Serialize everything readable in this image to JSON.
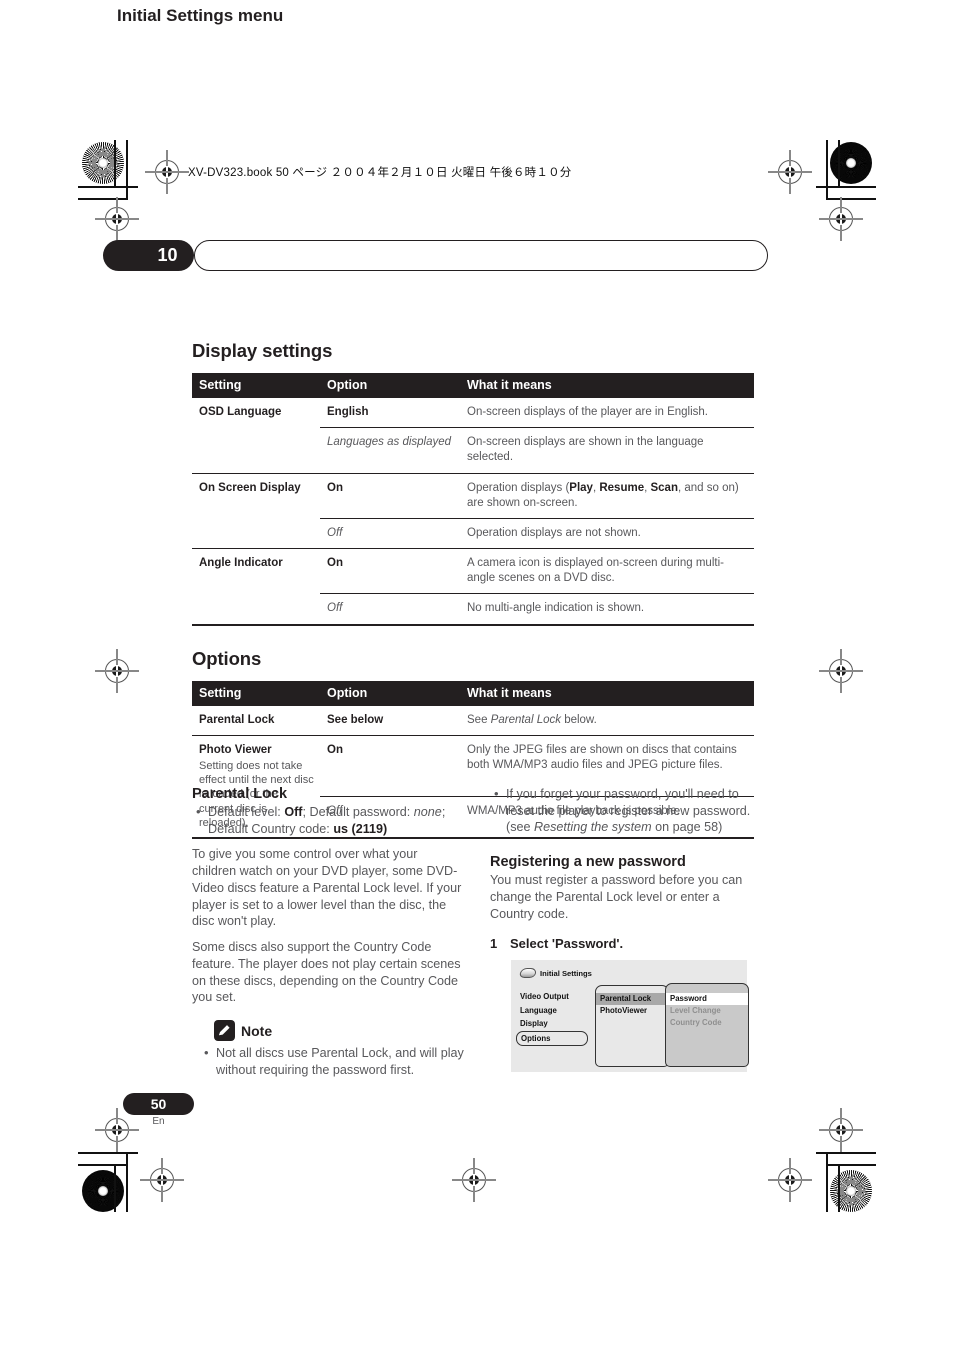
{
  "print": {
    "book_line": "XV-DV323.book  50 ページ  ２００４年２月１０日  火曜日  午後６時１０分"
  },
  "chapter": {
    "number": "10",
    "title": "Initial Settings menu"
  },
  "display_settings": {
    "heading": "Display settings",
    "columns": [
      "Setting",
      "Option",
      "What it means"
    ],
    "rows": [
      {
        "setting": "OSD Language",
        "setting_sub": "",
        "options": [
          {
            "option": "English",
            "style": "bold",
            "means": "On-screen displays of the player are in English."
          },
          {
            "option": "Languages as displayed",
            "style": "italic",
            "means": "On-screen displays are shown in the language selected."
          }
        ]
      },
      {
        "setting": "On Screen Display",
        "setting_sub": "",
        "options": [
          {
            "option": "On",
            "style": "bold",
            "means": "Operation displays (<b>Play</b>, <b>Resume</b>, <b>Scan</b>, and so on) are shown on-screen."
          },
          {
            "option": "Off",
            "style": "italic",
            "means": "Operation displays are not shown."
          }
        ]
      },
      {
        "setting": "Angle Indicator",
        "setting_sub": "",
        "options": [
          {
            "option": "On",
            "style": "bold",
            "means": "A camera icon is displayed on-screen during multi-angle scenes on a DVD disc."
          },
          {
            "option": "Off",
            "style": "italic",
            "means": "No multi-angle indication is shown."
          }
        ]
      }
    ]
  },
  "options_table": {
    "heading": "Options",
    "columns": [
      "Setting",
      "Option",
      "What it means"
    ],
    "rows": [
      {
        "setting": "Parental Lock",
        "setting_sub": "",
        "options": [
          {
            "option": "See below",
            "style": "bold",
            "means": "See <i>Parental Lock</i> below."
          }
        ]
      },
      {
        "setting": "Photo Viewer",
        "setting_sub": "Setting does not take effect until the next disc is loaded (or the current disc is reloaded).",
        "options": [
          {
            "option": "On",
            "style": "bold",
            "means": "Only the JPEG files are shown on discs that contains both WMA/MP3 audio files and JPEG picture files."
          },
          {
            "option": "Off",
            "style": "italic",
            "means": "WMA/MP3 audio file playback is possible."
          }
        ]
      }
    ]
  },
  "parental_lock": {
    "heading": "Parental Lock",
    "defaults_bullet": "Default level: <b>Off</b>; Default password: <i>none</i>; Default Country code: <b>us (2119)</b>",
    "paragraph1": "To give you some control over what your children watch on your DVD player, some DVD-Video discs feature a Parental Lock level. If your player is set to a lower level than the disc, the disc won't play.",
    "paragraph2": "Some discs also support the Country Code feature. The player does not play certain scenes on these discs, depending on the Country Code you set.",
    "note_label": "Note",
    "note_bullet": "Not all discs use Parental Lock, and will play without requiring the password first."
  },
  "right_column": {
    "forgot_bullet": "If you forget your password, you'll need to reset the player to register a new password. (see <i>Resetting the system</i> on page 58)",
    "registering_heading": "Registering a new password",
    "registering_body": "You must register a password before you can change the Parental Lock level or enter a Country code.",
    "step_number": "1",
    "step_text": "Select 'Password'."
  },
  "osd_mockup": {
    "title": "Initial Settings",
    "level1": [
      "Video Output",
      "Language",
      "Display",
      "Options"
    ],
    "level1_selected": "Options",
    "level2": [
      "Parental Lock",
      "PhotoViewer"
    ],
    "level2_selected": "Parental Lock",
    "level3": [
      "Password",
      "Level Change",
      "Country Code"
    ],
    "level3_selected": "Password",
    "level3_dimmed": [
      "Level Change",
      "Country Code"
    ]
  },
  "footer": {
    "page_number": "50",
    "language_code": "En"
  },
  "colors": {
    "ink": "#231f20",
    "body_text": "#58585b",
    "header_bar": "#231f20",
    "osd_background": "#e8e8e8",
    "osd_panel_dim": "#c9c9c9"
  }
}
